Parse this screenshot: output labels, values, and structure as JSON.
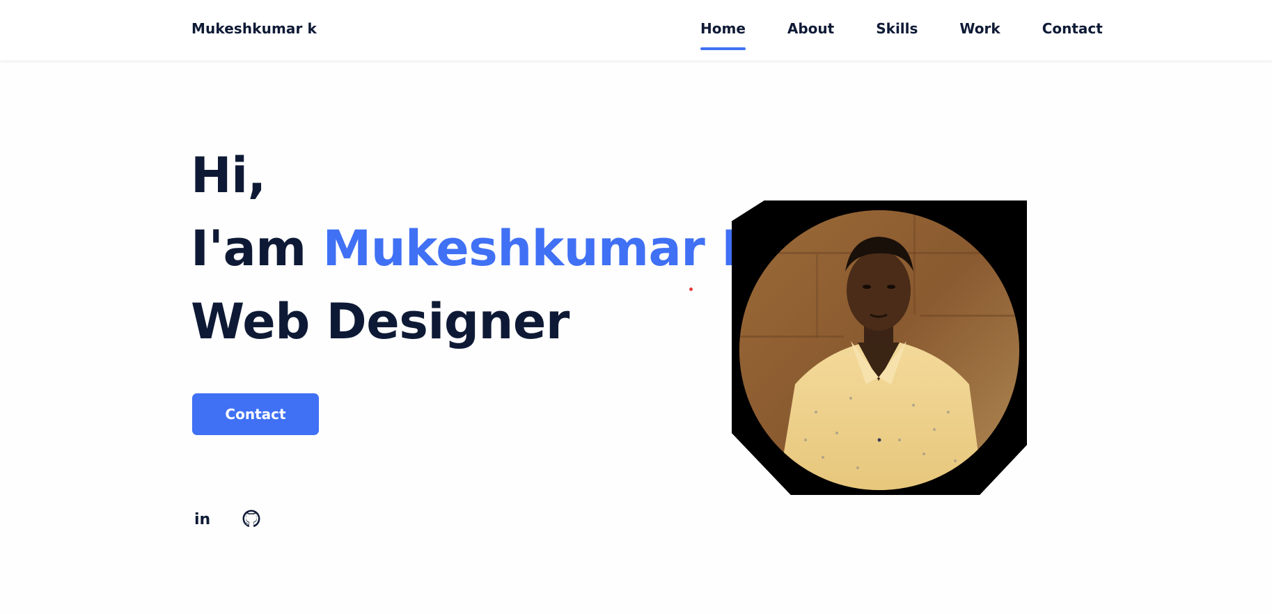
{
  "header": {
    "logo": "Mukeshkumar k",
    "nav": [
      {
        "label": "Home",
        "active": true
      },
      {
        "label": "About",
        "active": false
      },
      {
        "label": "Skills",
        "active": false
      },
      {
        "label": "Work",
        "active": false
      },
      {
        "label": "Contact",
        "active": false
      }
    ]
  },
  "hero": {
    "greeting": "Hi,",
    "intro_prefix": "I'am ",
    "name": "Mukeshkumar K",
    "role": "Web Designer",
    "button_label": "Contact"
  },
  "social": {
    "linkedin_icon": "in",
    "icons": [
      "linkedin-icon",
      "github-icon"
    ]
  },
  "colors": {
    "text": "#0e1a35",
    "accent": "#4070f4",
    "background": "#fefefe"
  }
}
